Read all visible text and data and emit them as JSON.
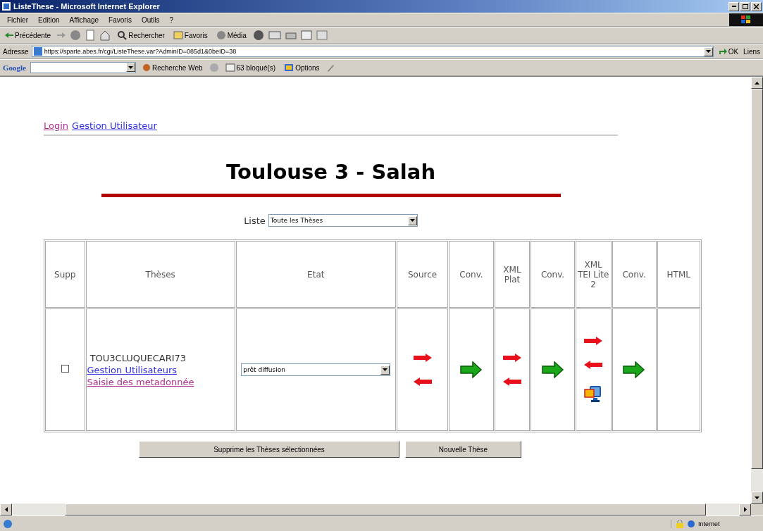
{
  "window": {
    "title": "ListeThese - Microsoft Internet Explorer"
  },
  "menu": [
    "Fichier",
    "Edition",
    "Affichage",
    "Favoris",
    "Outils",
    "?"
  ],
  "toolbar": {
    "back": "Précédente",
    "search": "Rechercher",
    "favorites": "Favoris",
    "media": "Média"
  },
  "address_bar": {
    "label": "Adresse",
    "value": "https://sparte.abes.fr/cgi/ListeThese.var?AdminID=085d1&0beID=38",
    "go": "OK",
    "links": "Liens"
  },
  "google_bar": {
    "logo": "Google",
    "search": "Recherche Web",
    "blocked": "63 bloqué(s)",
    "options": "Options"
  },
  "page": {
    "nav": [
      {
        "label": "Login",
        "visited": true
      },
      {
        "label": "Gestion Utilisateur",
        "visited": false
      }
    ],
    "heading": "Toulouse 3 - Salah",
    "list_filter": {
      "label": "Liste",
      "value": "Toute les Thèses"
    },
    "table": {
      "columns": [
        "Supp",
        "Thèses",
        "Etat",
        "Source",
        "Conv.",
        "XML Plat",
        "Conv.",
        "XML TEI Lite 2",
        "Conv.",
        "HTML"
      ],
      "rows": [
        {
          "checked": false,
          "id": "TOU3CLUQUECARI73",
          "links": [
            {
              "label": "Gestion Utilisateurs",
              "visited": false
            },
            {
              "label": "Saisie des metadonnée",
              "visited": true
            }
          ],
          "state": "prêt diffusion",
          "actions": [
            [
              {
                "kind": "export"
              },
              {
                "kind": "import"
              }
            ],
            [
              {
                "kind": "convert"
              }
            ],
            [
              {
                "kind": "export"
              },
              {
                "kind": "import"
              }
            ],
            [
              {
                "kind": "convert"
              }
            ],
            [
              {
                "kind": "export"
              },
              {
                "kind": "import"
              },
              {
                "kind": "view"
              }
            ],
            [
              {
                "kind": "convert"
              }
            ]
          ]
        }
      ]
    },
    "buttons": [
      "Supprime les Thèses sélectionnées",
      "Nouvelle Thèse"
    ]
  },
  "status_bar": {
    "zone": "Internet"
  }
}
